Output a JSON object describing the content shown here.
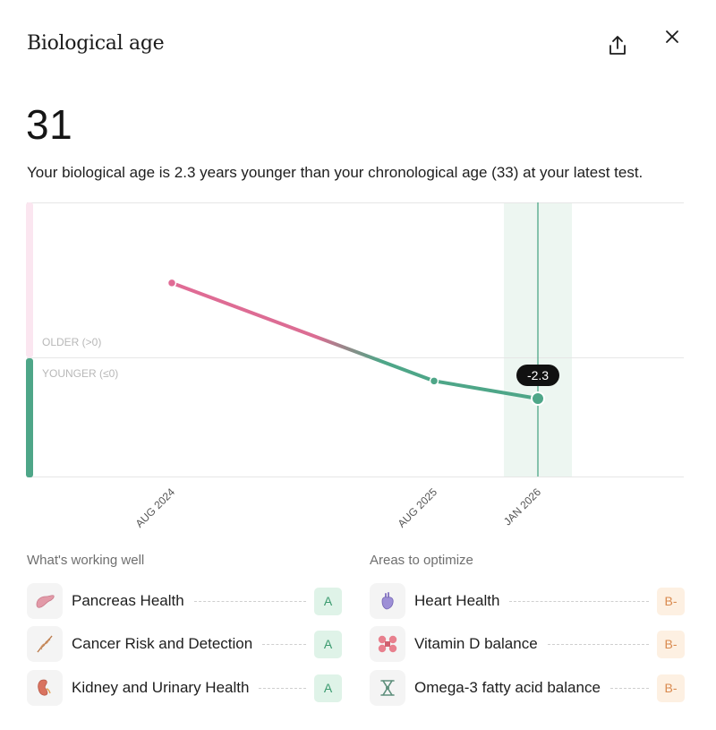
{
  "header": {
    "title": "Biological age"
  },
  "age": {
    "value": "31",
    "summary": "Your biological age is 2.3 years younger than your chronological age (33) at your latest test."
  },
  "chart_data": {
    "type": "line",
    "zones": {
      "upper": "OLDER (>0)",
      "lower": "YOUNGER (≤0)"
    },
    "x": [
      "AUG 2024",
      "AUG 2025",
      "JAN 2026"
    ],
    "values": [
      6.8,
      -2.1,
      -3.7
    ],
    "highlight_label": "-2.3",
    "colors": {
      "older": "#e06b95",
      "younger": "#4ea688",
      "older_band": "#fbe6f0",
      "highlight_band": "#edf6f1"
    }
  },
  "working_well": {
    "title": "What's working well",
    "items": [
      {
        "label": "Pancreas Health",
        "grade": "A",
        "icon": "pancreas-icon"
      },
      {
        "label": "Cancer Risk and Detection",
        "grade": "A",
        "icon": "dna-icon"
      },
      {
        "label": "Kidney and Urinary Health",
        "grade": "A",
        "icon": "kidney-icon"
      }
    ]
  },
  "optimize": {
    "title": "Areas to optimize",
    "items": [
      {
        "label": "Heart Health",
        "grade": "B-",
        "icon": "heart-icon"
      },
      {
        "label": "Vitamin D balance",
        "grade": "B-",
        "icon": "vitamin-d-icon"
      },
      {
        "label": "Omega-3 fatty acid balance",
        "grade": "B-",
        "icon": "omega-3-icon"
      }
    ]
  }
}
